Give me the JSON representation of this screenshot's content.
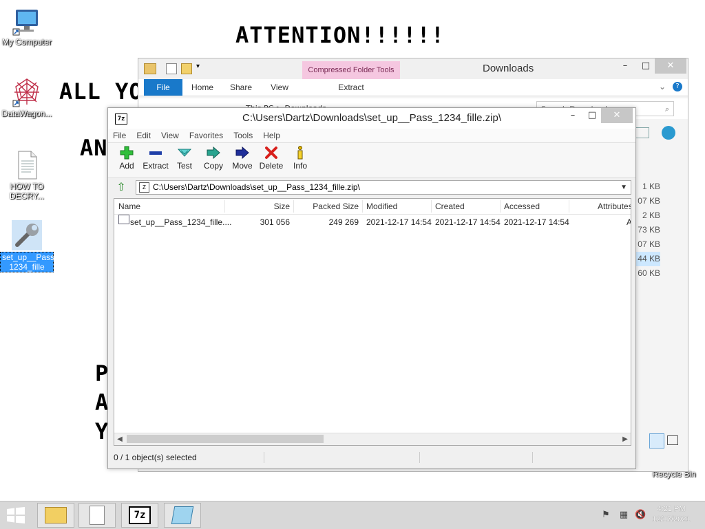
{
  "wallpaper": {
    "heading": "ATTENTION!!!!!!",
    "line1": "ALL YO",
    "line2": "AN",
    "line3": "P",
    "line4": "A",
    "line5": "Y"
  },
  "desktop_icons": [
    {
      "label": "My Computer",
      "icon": "computer-icon"
    },
    {
      "label": "DataWagon...",
      "icon": "datawagon-icon"
    },
    {
      "label": "HOW TO DECRY...",
      "icon": "text-document-icon"
    },
    {
      "label": "set_up__Pass_ 1234_fille",
      "icon": "setup-wrench-icon"
    },
    {
      "label": "Recycle Bin",
      "icon": "recycle-bin-icon"
    }
  ],
  "explorer": {
    "title": "Downloads",
    "context_tab": "Compressed Folder Tools",
    "tabs": [
      "File",
      "Home",
      "Share",
      "View"
    ],
    "context_subtab": "Extract",
    "breadcrumb": "This PC  >  Downloads",
    "search_placeholder": "Search Downloads",
    "sizes": [
      "1 KB",
      "07 KB",
      "2 KB",
      "73 KB",
      "07 KB",
      "44 KB",
      "60 KB"
    ]
  },
  "zip": {
    "title": "C:\\Users\\Dartz\\Downloads\\set_up__Pass_1234_fille.zip\\",
    "app_icon_text": "7z",
    "menu": [
      "File",
      "Edit",
      "View",
      "Favorites",
      "Tools",
      "Help"
    ],
    "toolbar": [
      {
        "label": "Add",
        "icon": "add-icon"
      },
      {
        "label": "Extract",
        "icon": "extract-icon"
      },
      {
        "label": "Test",
        "icon": "test-icon"
      },
      {
        "label": "Copy",
        "icon": "copy-icon"
      },
      {
        "label": "Move",
        "icon": "move-icon"
      },
      {
        "label": "Delete",
        "icon": "delete-icon"
      },
      {
        "label": "Info",
        "icon": "info-icon"
      }
    ],
    "path": "C:\\Users\\Dartz\\Downloads\\set_up__Pass_1234_fille.zip\\",
    "columns": [
      "Name",
      "Size",
      "Packed Size",
      "Modified",
      "Created",
      "Accessed",
      "Attributes"
    ],
    "rows": [
      {
        "name": "set_up__Pass_1234_fille....",
        "size": "301 056",
        "packed": "249 269",
        "modified": "2021-12-17 14:54",
        "created": "2021-12-17 14:54",
        "accessed": "2021-12-17 14:54",
        "attributes": "A"
      }
    ],
    "status": "0 / 1 object(s) selected"
  },
  "taskbar": {
    "time": "4:21 PM",
    "date": "12/17/2021",
    "apps": [
      "file-explorer-icon",
      "document-icon",
      "7zip-icon",
      "notepad-icon"
    ],
    "seven_zip_text": "7z"
  },
  "colors": {
    "file_tab": "#1979ca",
    "context_tab": "#f5c7e0",
    "selection": "#3399ff"
  }
}
